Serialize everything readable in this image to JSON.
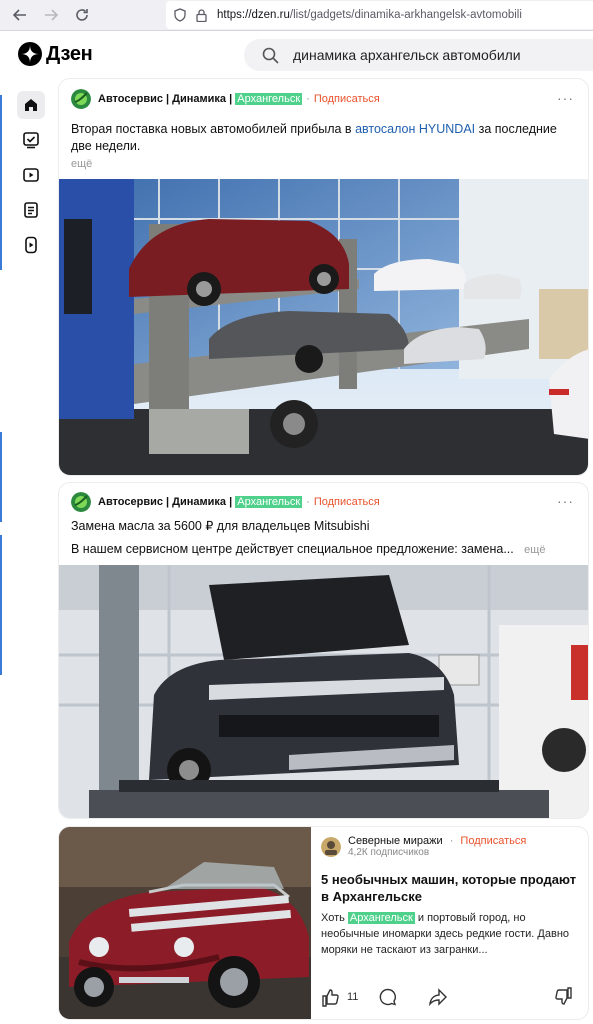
{
  "browser": {
    "url_host": "https://dzen.ru",
    "url_path": "/list/gadgets/dinamika-arkhangelsk-avtomobili"
  },
  "header": {
    "logo_text": "Дзен",
    "search_value": "динамика архангельск автомобили"
  },
  "nav_icons": [
    "home-icon",
    "tasks-icon",
    "video-icon",
    "article-icon",
    "shorts-icon"
  ],
  "colors": {
    "accent_green": "#4fd18b",
    "subscribe": "#e8522c",
    "link": "#1f5fae"
  },
  "cards": [
    {
      "channel": "Автосервис | Динамика |",
      "channel_hl": "Архангельск",
      "sep": "·",
      "subscribe": "Подписаться",
      "menu": "···",
      "text_before": "Вторая поставка новых автомобилей прибыла в",
      "link": "автосалон HYUNDAI",
      "text_after": "за последние две недели.",
      "more": "ещё"
    },
    {
      "channel": "Автосервис | Динамика |",
      "channel_hl": "Архангельск",
      "sep": "·",
      "subscribe": "Подписаться",
      "menu": "···",
      "title": "Замена масла за 5600 ₽ для владельцев Mitsubishi",
      "text": "В нашем сервисном центре действует специальное предложение: замена...",
      "more": "ещё"
    },
    {
      "channel": "Северные миражи",
      "sep": "·",
      "subscribe": "Подписаться",
      "subscribers": "4,2К подписчиков",
      "title": "5 необычных машин, которые продают в Архангельске",
      "body_before": "Хоть",
      "body_hl": "Архангельск",
      "body_after": "и портовый город, но необычные иномарки здесь редкие гости. Давно моряки не таскают из загранки...",
      "likes": "11"
    }
  ]
}
